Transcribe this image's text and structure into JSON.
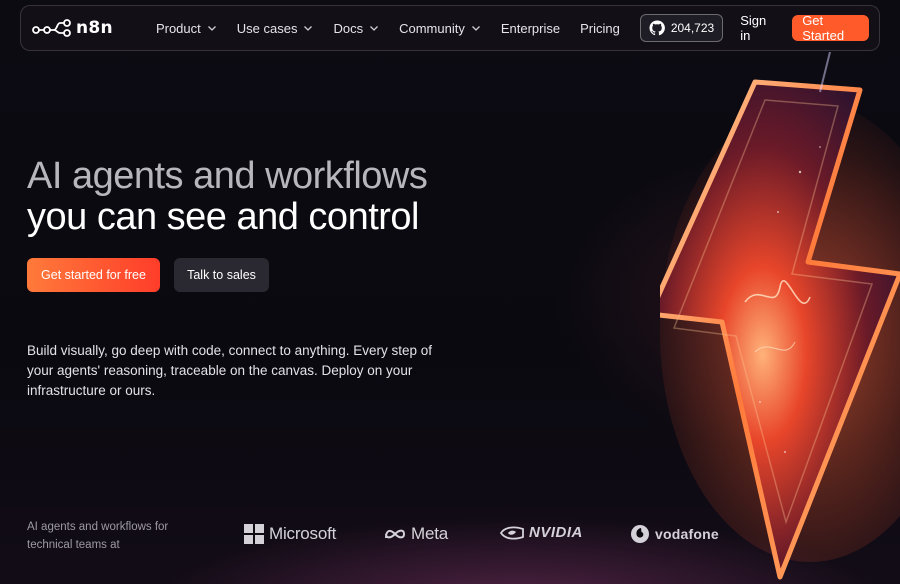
{
  "nav": {
    "logo_text": "n8n",
    "items": [
      {
        "label": "Product",
        "dropdown": true
      },
      {
        "label": "Use cases",
        "dropdown": true
      },
      {
        "label": "Docs",
        "dropdown": true
      },
      {
        "label": "Community",
        "dropdown": true
      },
      {
        "label": "Enterprise",
        "dropdown": false
      },
      {
        "label": "Pricing",
        "dropdown": false
      }
    ],
    "github_stars": "204,723",
    "sign_in": "Sign in",
    "get_started": "Get Started"
  },
  "hero": {
    "title_line1": "AI agents and workflows",
    "title_line2": "you can see and control",
    "primary_cta": "Get started for free",
    "secondary_cta": "Talk to sales",
    "description": "Build visually, go deep with code, connect to anything. Every step of your agents' reasoning, traceable on the canvas. Deploy on your infrastructure or ours."
  },
  "logos": {
    "caption": "AI agents and workflows for technical teams at",
    "companies": [
      "Microsoft",
      "Meta",
      "NVIDIA",
      "vodafone"
    ]
  },
  "colors": {
    "accent": "#ff5a2a",
    "background": "#0c0a10"
  },
  "icons": {
    "github": "github-icon",
    "chevron": "chevron-down-icon",
    "logo": "n8n-logo-icon"
  }
}
